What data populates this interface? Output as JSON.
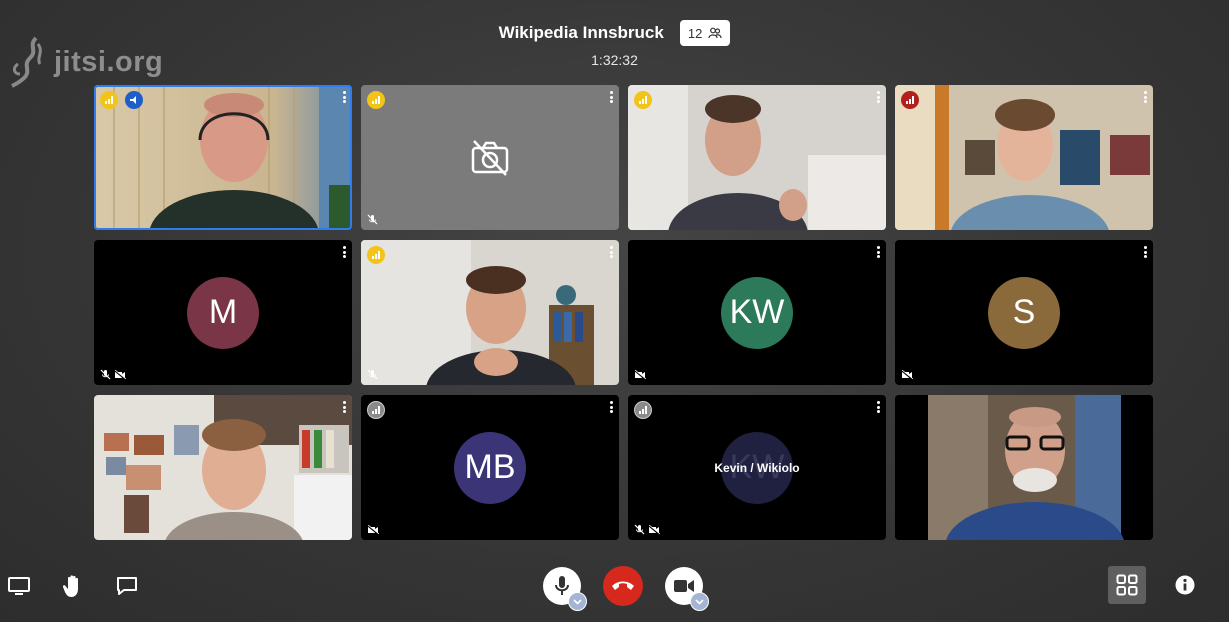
{
  "brand": {
    "logo_text": "jitsi.org"
  },
  "header": {
    "title": "Wikipedia Innsbruck",
    "participant_count": "12",
    "timer": "1:32:32"
  },
  "tiles": [
    {
      "kind": "video",
      "connection": "good",
      "dominant_speaker": true
    },
    {
      "kind": "camera-off",
      "connection": "good",
      "muted_audio": true
    },
    {
      "kind": "video",
      "connection": "good"
    },
    {
      "kind": "video",
      "connection": "bad"
    },
    {
      "kind": "avatar",
      "initials": "M",
      "color": "#7a3547",
      "muted_audio": true,
      "muted_video": true
    },
    {
      "kind": "video",
      "connection": "good",
      "muted_audio": true
    },
    {
      "kind": "avatar",
      "initials": "KW",
      "color": "#2c7a5a",
      "muted_video": true
    },
    {
      "kind": "avatar",
      "initials": "S",
      "color": "#8a6a3a",
      "muted_video": true
    },
    {
      "kind": "video"
    },
    {
      "kind": "avatar",
      "initials": "MB",
      "color": "#3b3577",
      "connection": "none",
      "muted_video": true
    },
    {
      "kind": "avatar",
      "initials": "KW",
      "color": "#202040",
      "connection": "none",
      "display_name": "Kevin / Wikiolo",
      "muted_audio": true,
      "muted_video": true
    },
    {
      "kind": "video"
    }
  ],
  "colors": {
    "accent": "#2f7cf0",
    "hangup": "#d7281e",
    "connection_good": "#f2c318",
    "connection_bad": "#b31e1e"
  },
  "icons": [
    "screen-share-icon",
    "raise-hand-icon",
    "chat-icon",
    "microphone-icon",
    "hangup-icon",
    "camera-icon",
    "tile-view-icon",
    "info-icon"
  ]
}
